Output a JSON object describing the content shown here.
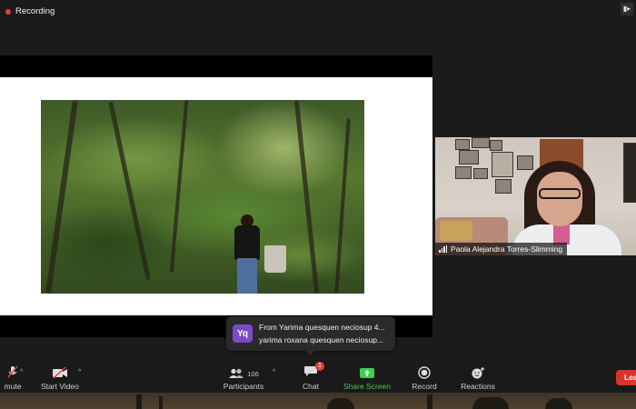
{
  "recording": {
    "label": "Recording",
    "color": "#e0413a"
  },
  "participant": {
    "name": "Paola Alejandra Torres-Slimming"
  },
  "chat_toast": {
    "avatar_initials": "Yq",
    "avatar_color": "#7a4bc7",
    "line1": "From Yarima quesquen neciosup 4...",
    "line2": "yarima roxana quesquen neciosup..."
  },
  "toolbar": {
    "mute_label": "mute",
    "start_video_label": "Start Video",
    "participants_label": "Participants",
    "participants_count": "106",
    "chat_label": "Chat",
    "chat_unread": "1",
    "share_label": "Share Screen",
    "share_color": "#3fce4f",
    "record_label": "Record",
    "reactions_label": "Reactions",
    "leave_label": "Leave",
    "leave_color": "#d7362c"
  }
}
